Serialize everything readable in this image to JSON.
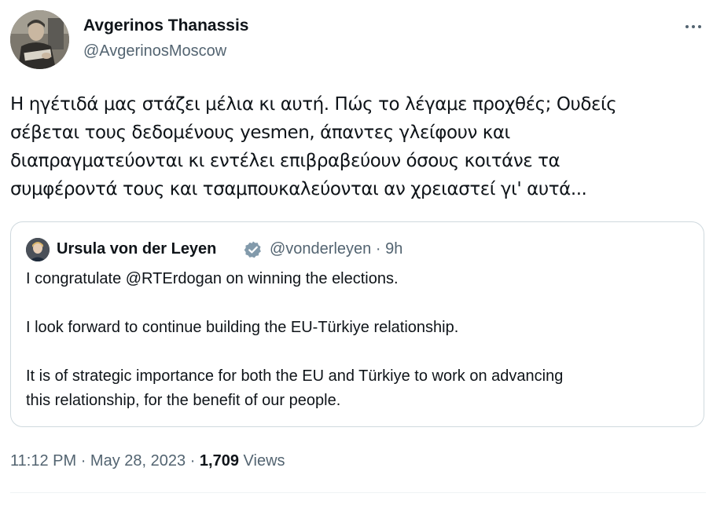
{
  "author": {
    "name": "Avgerinos Thanassis",
    "handle": "@AvgerinosMoscow"
  },
  "more_icon": "more-horizontal-icon",
  "tweet": {
    "text": "Η ηγέτιδά μας στάζει μέλια κι αυτή. Πώς το λέγαμε προχθές; Ουδείς\nσέβεται τους δεδομένους yesmen, άπαντες γλείφουν και\nδιαπραγματεύονται κι εντέλει επιβραβεύουν όσους κοιτάνε τα\nσυμφέροντά τους και τσαμπουκαλεύονται αν χρειαστεί γι' αυτά..."
  },
  "quote": {
    "name": "Ursula von der Leyen",
    "verified_icon": "verified-badge-icon",
    "verified_color": "#829aab",
    "handle": "@vonderleyen",
    "separator": "·",
    "time": "9h",
    "text": "I congratulate @RTErdogan on winning the elections.\n\nI look forward to continue building the EU-Türkiye relationship.\n\nIt is of strategic importance for both the EU and Türkiye to work on advancing\nthis relationship, for the benefit of our people."
  },
  "footer": {
    "time": "11:12 PM",
    "sep1": "·",
    "date": "May 28, 2023",
    "sep2": "·",
    "views_count": "1,709",
    "views_label": "Views"
  },
  "colors": {
    "text_primary": "#0f1419",
    "text_secondary": "#536471",
    "border": "#cfd9de"
  }
}
